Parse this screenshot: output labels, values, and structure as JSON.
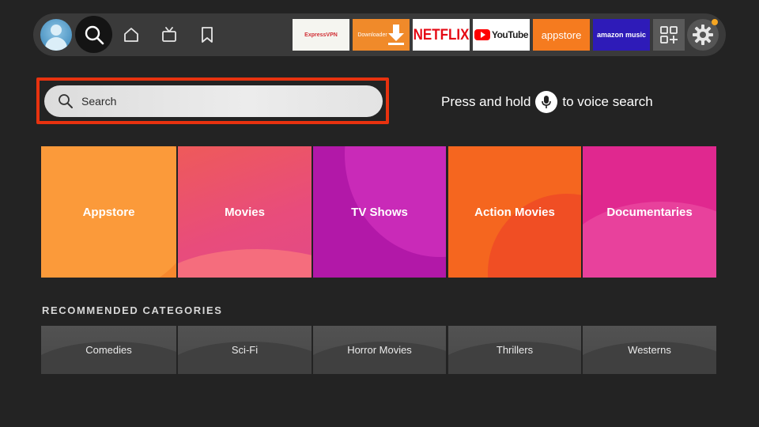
{
  "nav": {
    "icons": [
      "profile-avatar",
      "search-icon",
      "home-icon",
      "live-tv-icon",
      "bookmark-icon"
    ],
    "apps": [
      {
        "label": "ExpressVPN"
      },
      {
        "label": "Downloader"
      },
      {
        "label": "NETFLIX"
      },
      {
        "label": "YouTube"
      },
      {
        "label": "appstore"
      },
      {
        "label": "amazon music"
      }
    ],
    "colors": {
      "accent_focus": "#e8320f",
      "notification": "#f5a623"
    }
  },
  "search": {
    "placeholder": "Search",
    "voice_prefix": "Press and hold",
    "voice_suffix": "to voice search"
  },
  "categories": [
    {
      "label": "Appstore"
    },
    {
      "label": "Movies"
    },
    {
      "label": "TV Shows"
    },
    {
      "label": "Action Movies"
    },
    {
      "label": "Documentaries"
    }
  ],
  "recommended": {
    "title": "RECOMMENDED CATEGORIES",
    "items": [
      {
        "label": "Comedies"
      },
      {
        "label": "Sci-Fi"
      },
      {
        "label": "Horror Movies"
      },
      {
        "label": "Thrillers"
      },
      {
        "label": "Westerns"
      }
    ]
  }
}
